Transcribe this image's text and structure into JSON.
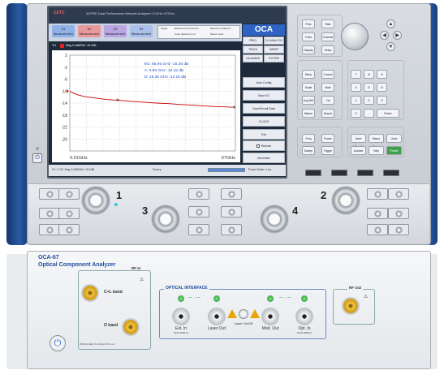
{
  "unit1": {
    "brand": "CETC",
    "header_text": "ACPRE Dual Performance Network Analyzer  0.1GHz~67GHz",
    "tabs": [
      {
        "title": "S1",
        "sub": "Measurement"
      },
      {
        "title": "S2",
        "sub": "Measurement"
      },
      {
        "title": "S3",
        "sub": "Measurement"
      },
      {
        "title": "S4",
        "sub": "Measurement"
      }
    ],
    "option_labels": [
      "Single",
      "Balanced transmission",
      "Balanced reflection",
      "Coax defined (mm)",
      "Mixed mode"
    ],
    "oca_label": "OCA",
    "softkeys_top": [
      "FREQ",
      "CH ANALYSIS",
      "TRACE",
      "SWEEP",
      "CAL&MEAS",
      "SYSTEM"
    ],
    "softkeys": [
      "Auto Config",
      "Save I/O",
      "Save/Recall Data",
      "CLOCK",
      "Exit"
    ],
    "remote_label": "Remote",
    "more_label": "MoreIdea",
    "trace_tag": "Tr1",
    "trace_desc": "Mag 0.0dB/Ref -15.0dB",
    "y_ticks": [
      "2",
      "-2",
      "-6",
      "-10",
      "-14",
      "-18",
      "-22",
      "-26"
    ],
    "x_start": "0.01GHz",
    "x_stop": "67GHz",
    "markers": [
      "M1: 66.95 GHz  -15.35 dB",
      "A: 0.95 GHz  -10.15 dB",
      "D: 19.36 GHz  -13.16 dB"
    ],
    "status_left": "Ch 1  S21  Mag 0.0dB/Ref -15.0dB",
    "status_mid": "Sweep",
    "status_right": "Power Meter: Low",
    "key_groups": {
      "instrument": [
        "Pres",
        "Start",
        "Trace",
        "Channel",
        "Display",
        "Setup"
      ],
      "navigate": [
        "Menu",
        "Control",
        "Scale",
        "Mark",
        "Avg BW",
        "Cal",
        "Marker",
        "Search"
      ],
      "stimulus": [
        "Freq",
        "Power",
        "Sweep",
        "Trigger"
      ],
      "utility": [
        "Save Recall",
        "Macro Setup",
        "Undo",
        "Autoset",
        "Help",
        "Preset"
      ],
      "numpad": [
        "7",
        "8",
        "9",
        "4",
        "5",
        "6",
        "1",
        "2",
        "3",
        "0",
        ".",
        "Enter"
      ]
    },
    "port_numbers": [
      "1",
      "2",
      "3",
      "4"
    ]
  },
  "unit2": {
    "model": "OCA-67",
    "title": "Optical Component Analyzer",
    "rf_in_label": "RF In",
    "rf_out_label": "RF Out",
    "cl_band_label": "C+L band",
    "o_band_label": "O band",
    "serial_text": "PRODUCED IN CHINA  SN: xxxx",
    "optical_interface_label": "OPTICAL INTERFACE",
    "ext_in_label": "Ext. In",
    "ext_in_sub": "1310-1620nm",
    "laser_out_label": "Laser Out",
    "laser_onoff_label": "Laser On/Off",
    "mod_out_label": "Mod. Out",
    "opt_in_label": "Opt. In",
    "opt_in_sub": "1310-1650nm"
  },
  "chart_data": {
    "type": "line",
    "title": "",
    "xlabel": "",
    "ylabel": "",
    "xlim": [
      0.01,
      67
    ],
    "ylim": [
      -30,
      2
    ],
    "x": [
      0.01,
      1,
      3,
      6,
      10,
      15,
      20,
      25,
      30,
      35,
      40,
      45,
      50,
      55,
      60,
      67
    ],
    "series": [
      {
        "values": [
          -10.0,
          -10.5,
          -11.2,
          -11.8,
          -12.3,
          -12.8,
          -13.1,
          -13.4,
          -13.7,
          -14.0,
          -14.2,
          -14.5,
          -14.7,
          -15.0,
          -15.2,
          -15.4
        ]
      }
    ],
    "color": "#cc0000",
    "grid": true
  }
}
